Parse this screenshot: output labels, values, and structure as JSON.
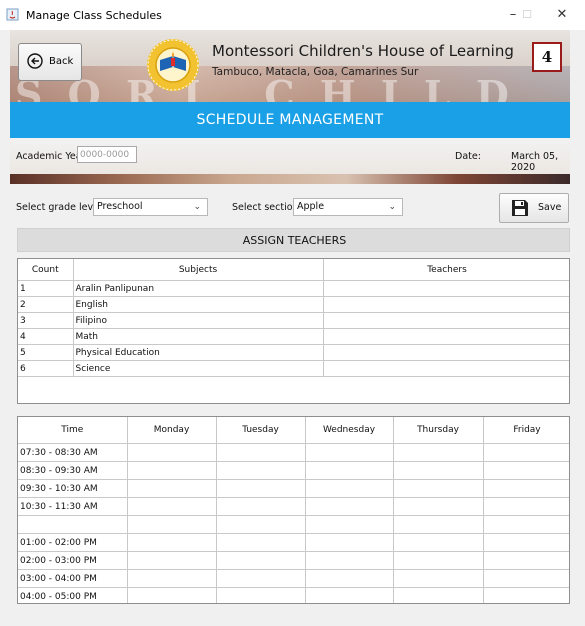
{
  "window": {
    "title": "Manage Class Schedules",
    "minimize": "–",
    "maximize": "☐",
    "close": "✕"
  },
  "header": {
    "back_label": "Back",
    "school_name": "Montessori Children's House of Learning",
    "school_address": "Tambuco, Matacla, Goa, Camarines Sur",
    "page_number": "4",
    "section_title": "SCHEDULE MANAGEMENT"
  },
  "info": {
    "academic_year_label": "Academic Year:",
    "academic_year_placeholder": "0000-0000",
    "date_label": "Date:",
    "date_value": "March 05, 2020"
  },
  "controls": {
    "grade_label": "Select grade level:",
    "grade_value": "Preschool",
    "section_label": "Select section:",
    "section_value": "Apple",
    "save_label": "Save"
  },
  "assign": {
    "title": "ASSIGN TEACHERS",
    "columns": [
      "Count",
      "Subjects",
      "Teachers"
    ],
    "rows": [
      {
        "count": "1",
        "subject": "Aralin Panlipunan",
        "teacher": ""
      },
      {
        "count": "2",
        "subject": "English",
        "teacher": ""
      },
      {
        "count": "3",
        "subject": "Filipino",
        "teacher": ""
      },
      {
        "count": "4",
        "subject": "Math",
        "teacher": ""
      },
      {
        "count": "5",
        "subject": "Physical Education",
        "teacher": ""
      },
      {
        "count": "6",
        "subject": "Science",
        "teacher": ""
      }
    ]
  },
  "schedule": {
    "columns": [
      "Time",
      "Monday",
      "Tuesday",
      "Wednesday",
      "Thursday",
      "Friday"
    ],
    "times": [
      "07:30 - 08:30 AM",
      "08:30 - 09:30 AM",
      "09:30 - 10:30 AM",
      "10:30 - 11:30 AM",
      "",
      "01:00 - 02:00 PM",
      "02:00 - 03:00 PM",
      "03:00 - 04:00 PM",
      "04:00 - 05:00 PM"
    ]
  },
  "colors": {
    "title_bar_blue": "#1aa0e6",
    "page_box_border": "#9b1b1b"
  }
}
